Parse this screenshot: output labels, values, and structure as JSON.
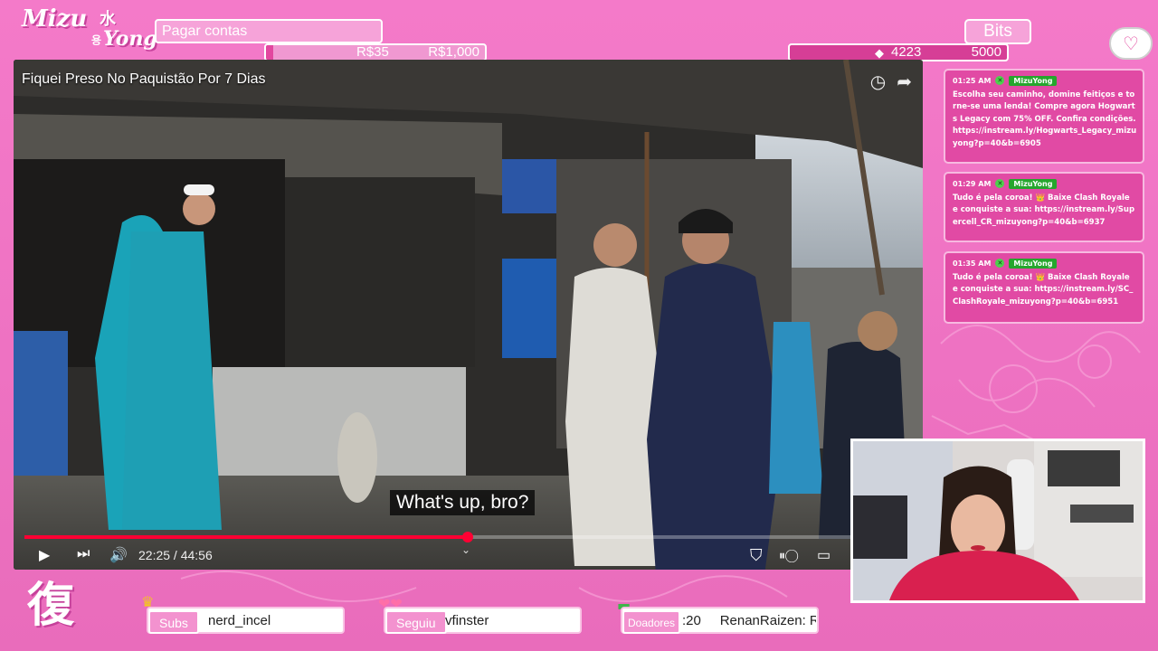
{
  "logo": {
    "main": "Mizu",
    "kanji": "水",
    "sub": "Yong",
    "hangul": "용"
  },
  "goal": {
    "title": "Pagar contas",
    "current": "R$35",
    "target": "R$1,000",
    "progress": 0.035
  },
  "bits": {
    "title": "Bits",
    "current": "4223",
    "target": "5000",
    "progress": 0.8446
  },
  "video": {
    "title": "Fiquei Preso No Paquistão Por 7 Dias",
    "subtitle": "What's up, bro?",
    "time": "22:25 / 44:56",
    "progress": 0.499
  },
  "chat": {
    "messages": [
      {
        "time": "01:25 AM",
        "user": "MizuYong",
        "text": "Escolha seu caminho, domine feitiços e torne-se uma lenda! Compre agora Hogwarts Legacy com 75% OFF. Confira condições. https://instream.ly/Hogwarts_Legacy_mizuyong?p=40&b=6905"
      },
      {
        "time": "01:29 AM",
        "user": "MizuYong",
        "text": "Tudo é pela coroa! 👑 Baixe Clash Royale e conquiste a sua: https://instream.ly/Supercell_CR_mizuyong?p=40&b=6937"
      },
      {
        "time": "01:35 AM",
        "user": "MizuYong",
        "text": "Tudo é pela coroa! 👑 Baixe Clash Royale e conquiste a sua: https://instream.ly/SC_ClashRoyale_mizuyong?p=40&b=6951"
      }
    ]
  },
  "bottom": {
    "kanji": "復",
    "subs": {
      "label": "Subs",
      "value": "nerd_incel"
    },
    "seguiu": {
      "label": "Seguiu",
      "value": "vfinster"
    },
    "doadores": {
      "label": "Doadores",
      "value": ":20     RenanRaizen: R"
    }
  },
  "colors": {
    "accent": "#e2479f",
    "panel": "#f6a3d9",
    "chat_bg": "#e14aa4",
    "progress_red": "#ff0033"
  }
}
